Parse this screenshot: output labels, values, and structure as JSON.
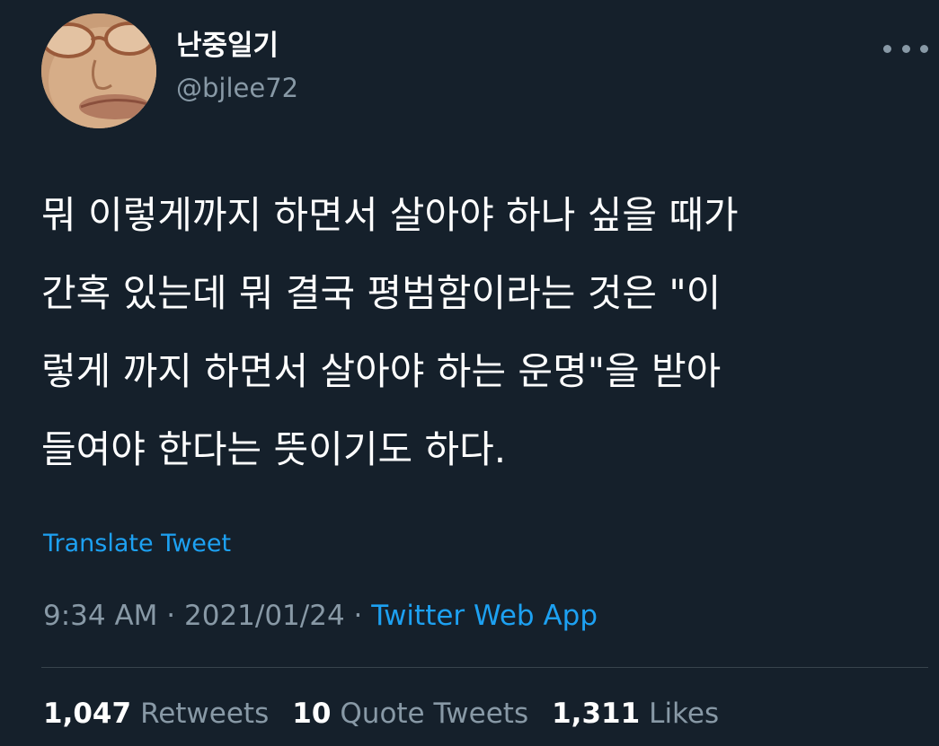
{
  "author": {
    "display_name": "난중일기",
    "handle": "@bjlee72"
  },
  "more_icon": "more-dots-icon",
  "tweet": {
    "lines": [
      "뭐 이렇게까지 하면서 살아야 하나 싶을 때가",
      "간혹 있는데 뭐 결국 평범함이라는 것은 \"이",
      "렇게 까지 하면서 살아야 하는 운명\"을 받아",
      "들여야 한다는 뜻이기도 하다."
    ]
  },
  "translate_label": "Translate Tweet",
  "meta": {
    "time": "9:34 AM",
    "separator": "·",
    "date": "2021/01/24",
    "source": "Twitter Web App"
  },
  "stats": {
    "retweets_count": "1,047",
    "retweets_label": "Retweets",
    "quotes_count": "10",
    "quotes_label": "Quote Tweets",
    "likes_count": "1,311",
    "likes_label": "Likes"
  },
  "colors": {
    "background": "#15202b",
    "text": "#ffffff",
    "secondary": "#8899a6",
    "link": "#1da1f2",
    "divider": "#38444d"
  }
}
